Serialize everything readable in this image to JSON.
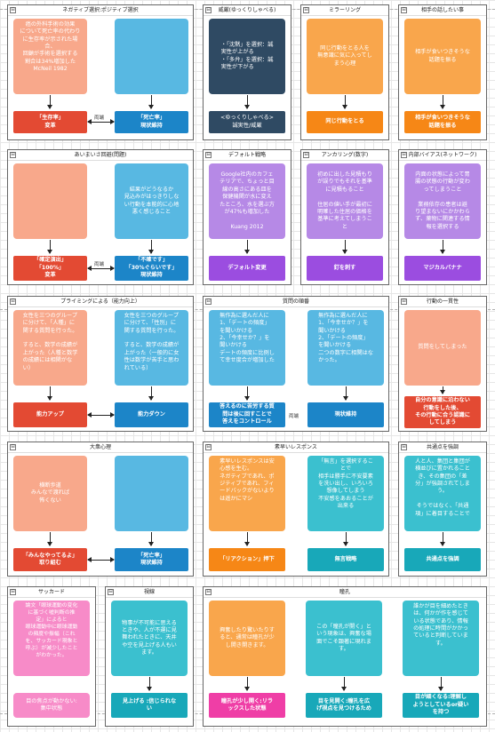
{
  "common": {
    "mutual": "両端",
    "minimize": "⊟"
  },
  "panels": {
    "p1": {
      "title": "ネガティブ選択:ポジティブ選択",
      "b1": "癌の外科手術の効果\nについて死亡率の代わり\nに生存率が示された場\n合、\n回顧が手術を選択する\n割合は34%増加した\nMcNeil 1982",
      "b2": "",
      "b3": "「生存率」\n変革",
      "b4": "「死亡率」\n現状維持"
    },
    "p2": {
      "title": "威厳(ゆっくりしゃべる)",
      "b1": "・「沈黙」を選択：誠\n実性が上がる\n・「多弁」を選択：誠\n実性が下がる",
      "b2": "<ゆっくりしゃべる>\n誠実性/威厳"
    },
    "p3": {
      "title": "ミラーリング",
      "b1": "同じ行動をとる人を\n無意識に気に入ってし\nまう心理",
      "b2": "同じ行動をとる"
    },
    "p4": {
      "title": "相手の話したい事",
      "b1": "相手が食いつきそうな\n話題を振る",
      "b2": "相手が食いつきそうな\n話題を振る"
    },
    "p5": {
      "title": "あいまいさ回避(問題)",
      "b1": "",
      "b2": "結果がどうなるか\n見込みがはっきりしな\nい行動を本能的に心地\n悪く感じること",
      "b3": "「確定演出」\n「100%」\n変革",
      "b4": "「不確です」\n「30%ぐらいです」\n現状維持"
    },
    "p6": {
      "title": "デフォルト戦略",
      "b1": "Google社内のカフェ\nテリアで、ちょっと目\n線の高さにある皿を\n保健機関が水に変え\nたところ、水を選ぶ方\nが47%も増加した\n\nKuang 2012",
      "b2": "デフォルト変更"
    },
    "p7": {
      "title": "アンカリング(数字)",
      "b1": "初めに出した見積もり\nが誤りでもそれを基準\nに見積もること\n\n住居の値い手が最初に\n明確した住居の価格を\n基準に考えてしまうこ\nと",
      "b2": "釘を刺す"
    },
    "p8": {
      "title": "内部バイアス(ネットワーク)",
      "b1": "内面の状態によって胃\n腸の状態の行動が変わ\nってしまうこと\n\n業務依存の患者は避\nり望まないにかかわら\nず、薬物に関連する情\n報を選択する",
      "b2": "マジカルバナナ"
    },
    "p9": {
      "title": "プライミングによる（能力向上）",
      "b1": "女性を三つのグループ\nに分けて、「人種」に\n関する質問を行った。\n\nすると、数学の成績が\n上がった（人種と数学\nの成績には相関がな\nい）",
      "b2": "女性を三つのグループ\nに分けて、「性別」に\n関する質問を行った。\n\nすると、数学の成績が\n上がった（一般的に女\n性は数学が苦手と思わ\nれている）",
      "b3": "能力アップ",
      "b4": "能力ダウン"
    },
    "p10": {
      "title": "質問の順番",
      "b1": "無作為に選んだ人に\n1、「デートの頻度」\nを聞いかける\n2、「今幸せか？」を\n聞いかける\nデートの頻度に比例し\nて幸せ度合が増加した",
      "b2": "無作為に選んだ人に\n1、「今幸せか？」を\n聞いかける\n2、「デートの頻度」\nを聞いかける\n二つの数字に相関はな\nかった。",
      "b3": "答えるのに苦労する質\n問は後に回すことで\n答えをコントロール",
      "b4": "現状維持"
    },
    "p11": {
      "title": "行動の一貫性",
      "b1": "質問をしてしまった",
      "b2": "自分の意識に沿わない\n行動をした後、\nその行動に合う認識に\nしてしまう"
    },
    "p12": {
      "title": "大衆心理",
      "b1": "横断歩道\nみんなで渡れば\n怖くない",
      "b2": "",
      "b3": "「みんなやってるよ」\n取り組む",
      "b4": "「死亡率」\n現状維持"
    },
    "p13": {
      "title": "素早いレスポンス",
      "b1": "素早いレスポンスは安\n心感を生む。\nネガティブであれ、ポ\nジティブであれ、フィ\nードバックがないより\nは遥かにマシ",
      "b2": "「無言」を選択するこ\nとで\n相手は勝手に不安要素\nを洗い出し、いろいろ\n想像してしまう\n不安感をあおることが\n出来る",
      "b3": "「リアクション」押下",
      "b4": "無言戦略"
    },
    "p14": {
      "title": "共通点を強調",
      "b1": "人と人、集団と集団が\n横並びに置かれること\nき、その集団の「差\n分」が強調されてしま\nう。\n\nそうではなく、「共通\n項」に着目することで",
      "b2": "共通点を強調"
    },
    "p15": {
      "title": "サッカード",
      "b1": "論文「眼球運動の変化\nに基づく嘘判断の推\n定」によると\n眼球運動中に眼球運動\nの頻度や振幅（これ\nを、サッカード現象と\n呼ぶ）が減少したこと\nがわかった。",
      "b2": "目の焦点が動かない:\n集中状態"
    },
    "p16": {
      "title": "視線",
      "b1": "物事が不可能に思える\nときや、人が不運に見\n舞われたときに、天井\nや空を見上げる人もい\nます。",
      "b2": "見上げる :信じられな\nい"
    },
    "p17": {
      "title": "瞳孔",
      "b1": "興奮したり驚いたりす\nると、通常は瞳孔が少\nし開き開きます。",
      "b2": "この「瞳孔が開く」と\nいう現象は、興奮な場\n面でこそ顕著に現れま\nす。",
      "b3": "誰かが目を細めたとき\nは、何かが作を感じて\nいる状態であり、情報\nの処理に時間がかかっ\nていると判断していま\nす。",
      "b4": "瞳孔が少し開く:リラ\nックスした状態",
      "b5": "目を見開く:瞳孔を広\nげ視点を見つけるため",
      "b6": "目が細くなる:理解し\nようとしているor疑い\nを持つ"
    }
  }
}
